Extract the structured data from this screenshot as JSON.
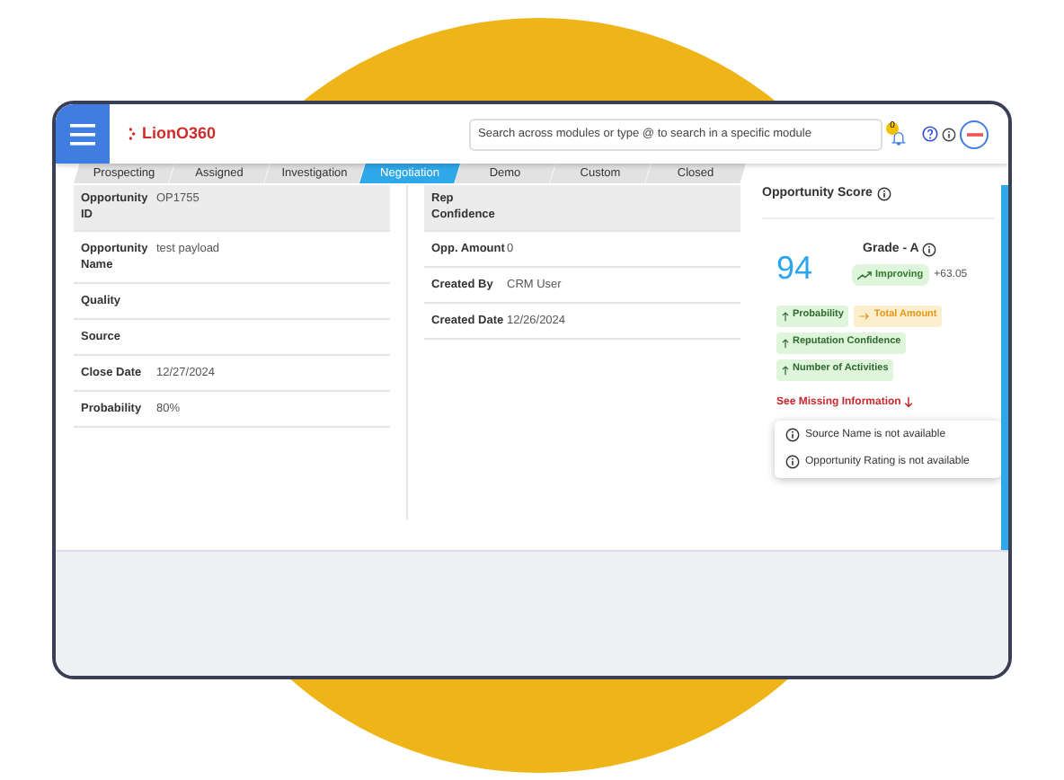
{
  "header": {
    "logo": "LionO360",
    "search": {
      "placeholder": "Search across modules or type @ to search in a specific module"
    },
    "notification_count": "0"
  },
  "stages": [
    {
      "label": "Prospecting",
      "selected": false
    },
    {
      "label": "Assigned",
      "selected": false
    },
    {
      "label": "Investigation",
      "selected": false
    },
    {
      "label": "Negotiation",
      "selected": true
    },
    {
      "label": "Demo",
      "selected": false
    },
    {
      "label": "Custom",
      "selected": false
    },
    {
      "label": "Closed",
      "selected": false
    }
  ],
  "details_left": [
    {
      "label": "Opportunity ID",
      "value": "OP1755"
    },
    {
      "label": "Opportunity Name",
      "value": "test payload"
    },
    {
      "label": "Quality"
    },
    {
      "label": "Source"
    },
    {
      "label": "Close Date",
      "value": "12/27/2024"
    },
    {
      "label": "Probability",
      "value": "80%"
    }
  ],
  "details_right": [
    {
      "label": "Rep Confidence"
    },
    {
      "label": "Opp. Amount",
      "value": "0"
    },
    {
      "label": "Created By",
      "value": "CRM User"
    },
    {
      "label": "Created Date",
      "value": "12/26/2024"
    }
  ],
  "score": {
    "title": "Opportunity Score",
    "value": "94",
    "grade": "Grade - A",
    "trend": "Improving",
    "change": "+63.05",
    "factors": [
      {
        "kind": "positive",
        "label": "Probability"
      },
      {
        "kind": "neutral",
        "label": "Total Amount"
      },
      {
        "kind": "positive",
        "label": "Reputation Confidence"
      },
      {
        "kind": "positive",
        "label": "Number of Activities"
      }
    ],
    "missing_link": "See Missing Information",
    "missing": [
      "Source Name is not available",
      "Opportunity Rating is not available"
    ]
  }
}
